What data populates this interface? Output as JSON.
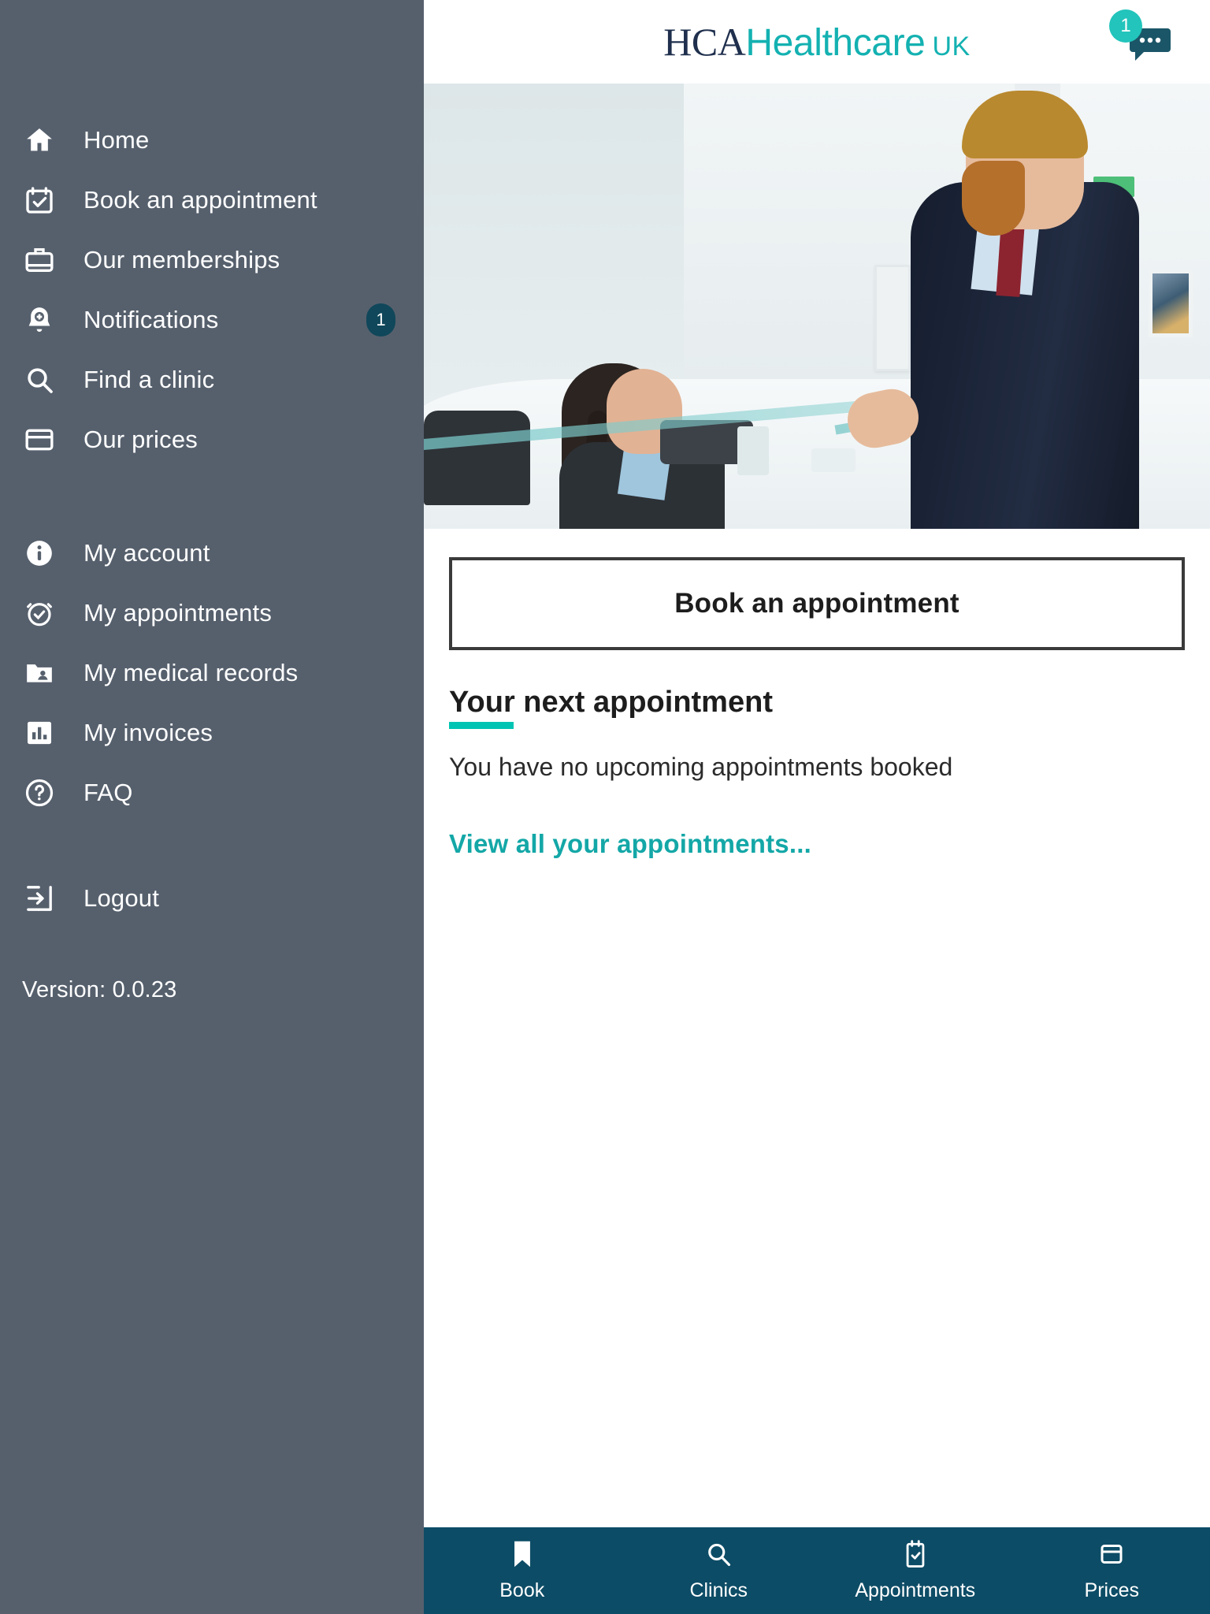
{
  "header": {
    "logo": {
      "hca": "HCA",
      "healthcare": "Healthcare",
      "uk": "UK"
    },
    "chat": {
      "icon": "chat-bubble-icon",
      "badge": "1"
    }
  },
  "sidebar": {
    "primary_items": [
      {
        "label": "Home",
        "icon": "home-icon",
        "badge": ""
      },
      {
        "label": "Book an appointment",
        "icon": "calendar-check-icon",
        "badge": ""
      },
      {
        "label": "Our memberships",
        "icon": "briefcase-icon",
        "badge": ""
      },
      {
        "label": "Notifications",
        "icon": "bell-plus-icon",
        "badge": "1"
      },
      {
        "label": "Find a clinic",
        "icon": "search-icon",
        "badge": ""
      },
      {
        "label": "Our prices",
        "icon": "credit-card-icon",
        "badge": ""
      }
    ],
    "secondary_items": [
      {
        "label": "My account",
        "icon": "info-circle-icon",
        "badge": ""
      },
      {
        "label": "My appointments",
        "icon": "alarm-check-icon",
        "badge": ""
      },
      {
        "label": "My medical records",
        "icon": "folder-person-icon",
        "badge": ""
      },
      {
        "label": "My invoices",
        "icon": "bar-chart-icon",
        "badge": ""
      },
      {
        "label": "FAQ",
        "icon": "question-circle-icon",
        "badge": ""
      }
    ],
    "logout": {
      "label": "Logout",
      "icon": "logout-icon"
    },
    "version": "Version: 0.0.23"
  },
  "main": {
    "hero_image_alt": "reception-desk-photo",
    "book_button": "Book an appointment",
    "section_title": "Your next appointment",
    "empty_state": "You have no upcoming appointments booked",
    "view_all_link": "View all your appointments..."
  },
  "bottom_nav": [
    {
      "label": "Book",
      "icon": "bookmark-icon"
    },
    {
      "label": "Clinics",
      "icon": "search-icon"
    },
    {
      "label": "Appointments",
      "icon": "calendar-check-icon"
    },
    {
      "label": "Prices",
      "icon": "credit-card-icon"
    }
  ],
  "colors": {
    "sidebar_bg": "#56606d",
    "brand_teal": "#14b1b1",
    "accent_teal": "#00c4b3",
    "badge_dark_teal": "#10475a",
    "bottom_nav_bg": "#0d4c66",
    "logo_navy": "#1f2f4d"
  }
}
